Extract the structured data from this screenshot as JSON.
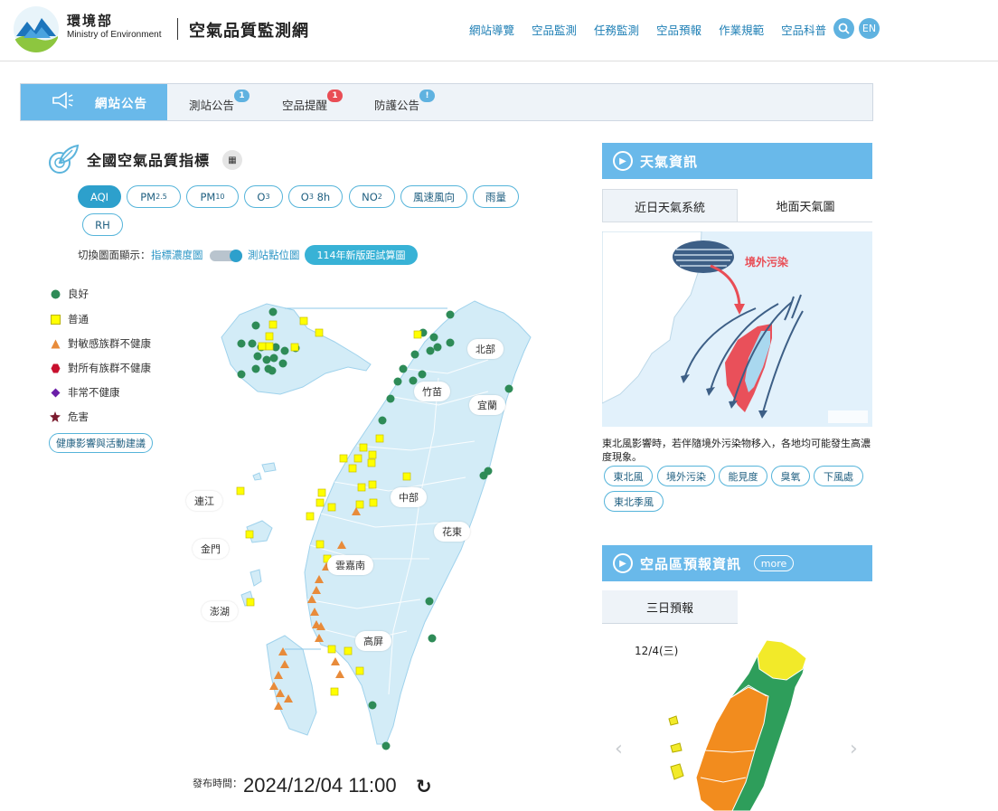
{
  "header": {
    "logo_zh": "環境部",
    "logo_en": "Ministry of Environment",
    "site_title": "空氣品質監測網",
    "nav": [
      "網站導覽",
      "空品監測",
      "任務監測",
      "空品預報",
      "作業規範",
      "空品科普"
    ],
    "lang": "EN"
  },
  "notice": {
    "main_label": "網站公告",
    "tabs": [
      {
        "label": "測站公告",
        "badge": "1",
        "badge_color": "#5fb2e0"
      },
      {
        "label": "空品提醒",
        "badge": "1",
        "badge_color": "#e94d55"
      },
      {
        "label": "防護公告",
        "badge": "!",
        "badge_color": "#5fb2e0"
      }
    ]
  },
  "aqi": {
    "title": "全國空氣品質指標",
    "pollutants": [
      "AQI",
      "PM2.5",
      "PM10",
      "O3",
      "O3 8h",
      "NO2",
      "風速風向",
      "雨量",
      "RH"
    ],
    "active": "AQI",
    "switch_label": "切換圖面顯示：",
    "switch_option_a": "指標濃度圖",
    "switch_option_b": "測站點位圖",
    "calc_button": "114年新版距試算圖",
    "legend": [
      {
        "label": "良好",
        "color": "#2e8b57",
        "shape": "circle"
      },
      {
        "label": "普通",
        "color": "#ffff00",
        "shape": "square"
      },
      {
        "label": "對敏感族群不健康",
        "color": "#e88b3a",
        "shape": "triangle"
      },
      {
        "label": "對所有族群不健康",
        "color": "#c8102e",
        "shape": "hexagon"
      },
      {
        "label": "非常不健康",
        "color": "#6b1ea8",
        "shape": "diamond"
      },
      {
        "label": "危害",
        "color": "#7b1b2e",
        "shape": "star"
      }
    ],
    "health_button": "健康影響與活動建議",
    "regions": [
      "北部",
      "竹苗",
      "宜蘭",
      "中部",
      "花東",
      "雲嘉南",
      "高屏",
      "連江",
      "金門",
      "澎湖"
    ],
    "publish_label": "發布時間：",
    "publish_time": "2024/12/04 11:00"
  },
  "weather": {
    "title": "天氣資訊",
    "tabs": [
      "近日天氣系統",
      "地面天氣圖"
    ],
    "image_label": "境外污染",
    "description": "東北風影響時，若伴隨境外污染物移入，各地均可能發生高濃度現象。",
    "tags": [
      "東北風",
      "境外污染",
      "能見度",
      "臭氧",
      "下風處",
      "東北季風"
    ]
  },
  "forecast": {
    "title": "空品區預報資訊",
    "more": "more",
    "tab": "三日預報",
    "date": "12/4(三)"
  }
}
